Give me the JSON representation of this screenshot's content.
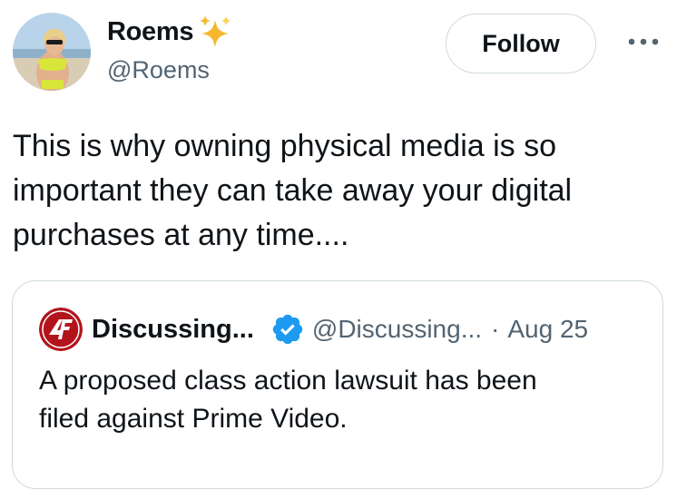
{
  "author": {
    "name": "Roems",
    "handle": "@Roems",
    "emoji_icon": "sparkles-icon"
  },
  "actions": {
    "follow_label": "Follow",
    "more_icon": "more-horizontal-icon"
  },
  "tweet": {
    "lines": [
      "This is why owning physical media is so",
      "important they can take away your digital",
      "purchases at any time...."
    ]
  },
  "quote": {
    "name": "Discussing...",
    "handle": "@Discussing...",
    "separator": "·",
    "date": "Aug 25",
    "verified_icon": "verified-badge-icon",
    "lines": [
      "A proposed class action lawsuit has been",
      "filed against Prime Video."
    ]
  },
  "colors": {
    "text_primary": "#0f1419",
    "text_secondary": "#536471",
    "border": "#cfd9de",
    "verified_blue": "#1d9bf0",
    "sparkle_gold": "#f4b400",
    "quote_logo_red": "#b3141c"
  }
}
